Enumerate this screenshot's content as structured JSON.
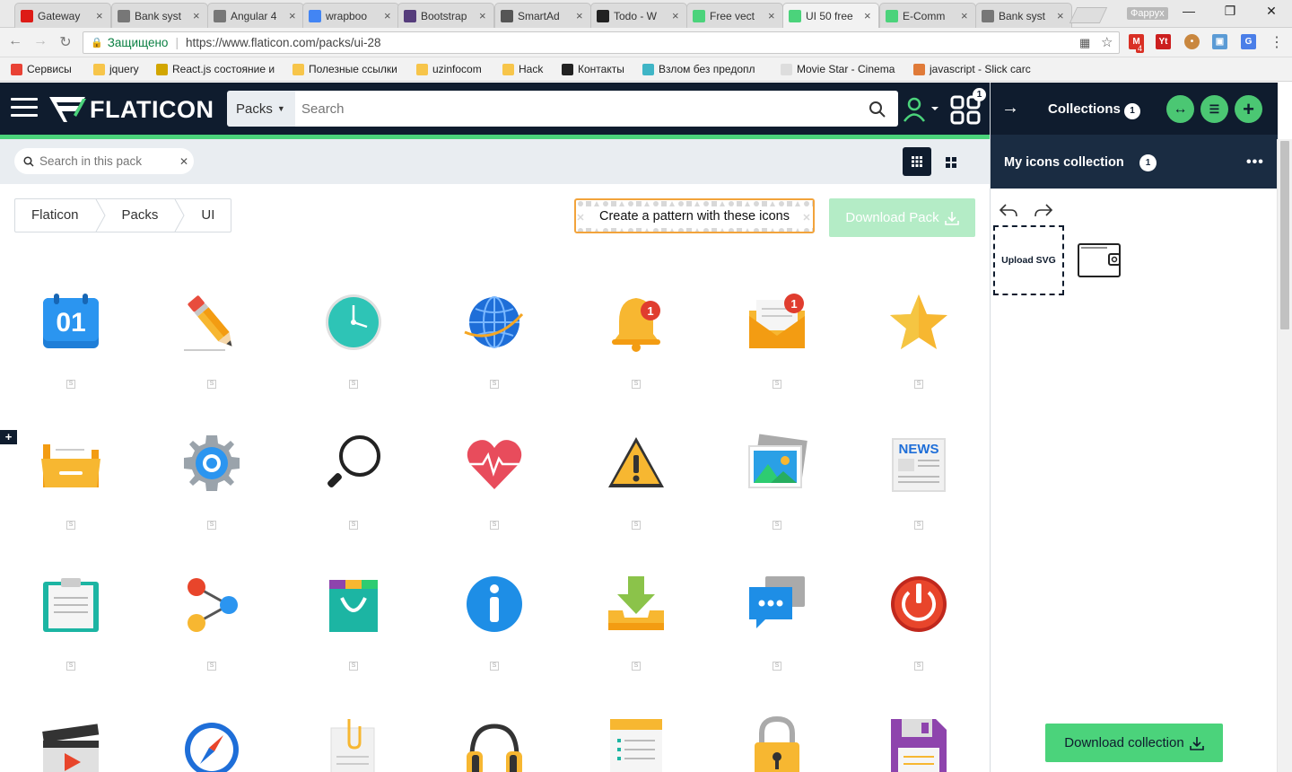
{
  "browser": {
    "tabs": [
      {
        "title": "Gateway",
        "icon": "angular-icon",
        "color": "#dd1b16"
      },
      {
        "title": "Bank syst",
        "icon": "page-icon",
        "color": "#777777"
      },
      {
        "title": "Angular 4",
        "icon": "page-icon",
        "color": "#777777"
      },
      {
        "title": "wrapboo",
        "icon": "google-icon",
        "color": "#4285f4"
      },
      {
        "title": "Bootstrap",
        "icon": "bootstrap-icon",
        "color": "#563d7c"
      },
      {
        "title": "SmartAd",
        "icon": "w-icon",
        "color": "#555555"
      },
      {
        "title": "Todo - W",
        "icon": "todo-icon",
        "color": "#222222"
      },
      {
        "title": "Free vect",
        "icon": "flaticon-icon",
        "color": "#4bd37b"
      },
      {
        "title": "UI 50 free",
        "icon": "flaticon-icon",
        "color": "#4bd37b"
      },
      {
        "title": "E-Comm",
        "icon": "flaticon-icon",
        "color": "#4bd37b"
      },
      {
        "title": "Bank syst",
        "icon": "page-icon",
        "color": "#777777"
      }
    ],
    "profile_name": "Фаррух",
    "secure_label": "Защищено",
    "url": "https://www.flaticon.com/packs/ui-28",
    "gmail_badge": "4",
    "bookmarks": [
      {
        "label": "Сервисы",
        "color": "#e94235"
      },
      {
        "label": "jquery",
        "color": "#f7c54a"
      },
      {
        "label": "React.js состояние и",
        "color": "#d2a600"
      },
      {
        "label": "Полезные ссылки",
        "color": "#f7c54a"
      },
      {
        "label": "uzinfocom",
        "color": "#f7c54a"
      },
      {
        "label": "Hack",
        "color": "#f7c54a"
      },
      {
        "label": "Контакты",
        "color": "#222222"
      },
      {
        "label": "Взлом без предопл",
        "color": "#3fb5c6"
      },
      {
        "label": "Movie Star - Cinema",
        "color": "#dddddd"
      },
      {
        "label": "javascript - Slick carc",
        "color": "#e07b39"
      }
    ]
  },
  "header": {
    "logo_text": "FLATICON",
    "packs_label": "Packs",
    "search_placeholder": "Search",
    "grid_badge": "1"
  },
  "sidebar": {
    "collections_label": "Collections",
    "collections_count": "1",
    "my_collection_label": "My icons collection",
    "my_collection_count": "1",
    "upload_label": "Upload SVG",
    "download_collection_label": "Download collection"
  },
  "toolbar": {
    "pack_search_placeholder": "Search in this pack"
  },
  "breadcrumb": [
    "Flaticon",
    "Packs",
    "UI"
  ],
  "actions": {
    "pattern_label": "Create a pattern with these icons",
    "download_pack_label": "Download Pack"
  },
  "icons": [
    {
      "name": "calendar-icon",
      "badge": "01"
    },
    {
      "name": "pencil-icon"
    },
    {
      "name": "clock-icon"
    },
    {
      "name": "globe-icon"
    },
    {
      "name": "bell-icon",
      "badge": "1"
    },
    {
      "name": "mail-icon",
      "badge": "1"
    },
    {
      "name": "star-icon"
    },
    {
      "name": "folder-icon"
    },
    {
      "name": "settings-gear-icon"
    },
    {
      "name": "magnifier-icon"
    },
    {
      "name": "heart-pulse-icon"
    },
    {
      "name": "warning-icon"
    },
    {
      "name": "image-gallery-icon"
    },
    {
      "name": "newspaper-icon",
      "badge": "NEWS"
    },
    {
      "name": "clipboard-icon"
    },
    {
      "name": "share-icon"
    },
    {
      "name": "shopping-bag-icon"
    },
    {
      "name": "info-icon"
    },
    {
      "name": "download-tray-icon"
    },
    {
      "name": "chat-icon"
    },
    {
      "name": "power-icon"
    },
    {
      "name": "clapperboard-icon"
    },
    {
      "name": "compass-icon"
    },
    {
      "name": "document-clip-icon"
    },
    {
      "name": "headphones-icon"
    },
    {
      "name": "notepad-icon"
    },
    {
      "name": "padlock-icon"
    },
    {
      "name": "floppy-disk-icon"
    }
  ]
}
